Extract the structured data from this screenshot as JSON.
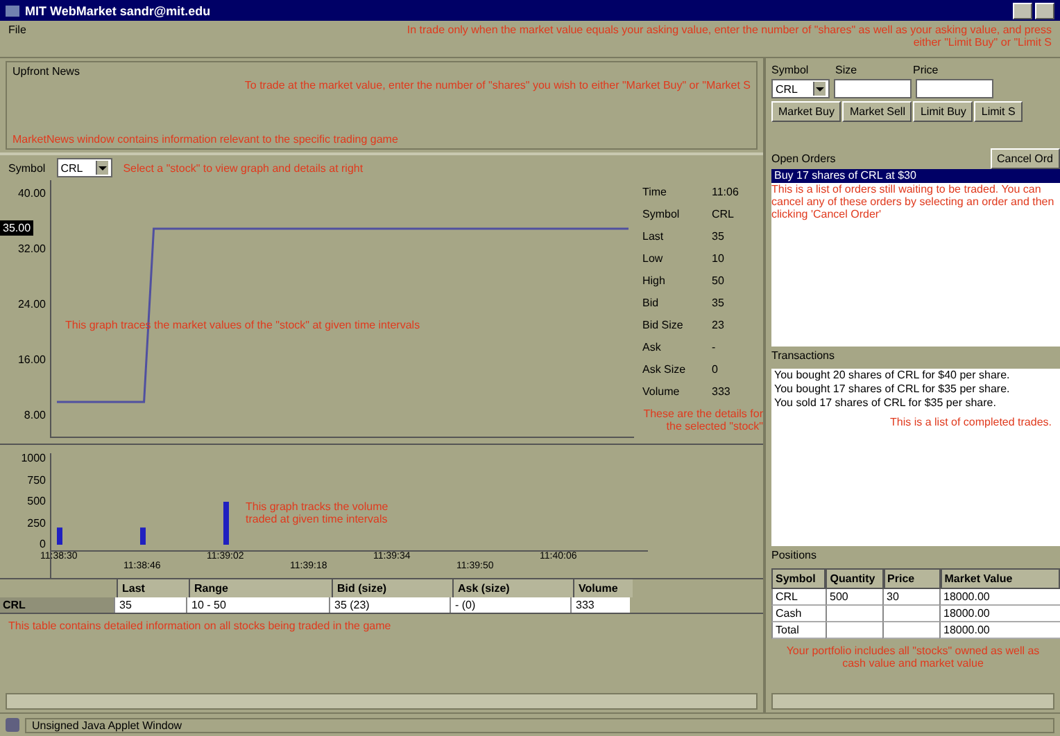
{
  "window": {
    "title": "MIT WebMarket  sandr@mit.edu"
  },
  "menu": [
    "File"
  ],
  "notes": {
    "limit": "In trade only when the market value equals your asking value, enter the number of \"shares\" as well as your asking value, and press either \"Limit Buy\" or \"Limit S",
    "market": "To trade at the market value, enter the number of \"shares\" you wish to either \"Market Buy\" or \"Market S",
    "news": "MarketNews window contains information relevant to the specific trading game",
    "select": "Select a \"stock\" to view graph and details at right",
    "price_graph": "This graph traces the market values of the \"stock\" at given time intervals",
    "details": "These are the details for the selected \"stock\"",
    "volume_graph": "This graph tracks the volume traded at given time intervals",
    "table": "This table contains detailed information on all stocks being traded in the game",
    "orders": "This is a list of orders still waiting to be traded. You can cancel any of these orders by selecting an order and then clicking 'Cancel Order'",
    "transactions": "This is a list of completed trades.",
    "positions": "Your portfolio includes all \"stocks\" owned as well as cash value and market value"
  },
  "news": {
    "title": "Upfront News"
  },
  "symbol_picker": {
    "label": "Symbol",
    "value": "CRL"
  },
  "price_chart": {
    "highlight": "35.00",
    "chart_data": {
      "type": "line",
      "categories": [
        null,
        null,
        null,
        null,
        null,
        null,
        null,
        null,
        null,
        null,
        null,
        null,
        null,
        null,
        null,
        null,
        null,
        null,
        null,
        null,
        null,
        null,
        null,
        null,
        null,
        null,
        null,
        null,
        null,
        null,
        null,
        null,
        null,
        null,
        null,
        null,
        null,
        null,
        null,
        null,
        null,
        null,
        null,
        null,
        null,
        null,
        null,
        null,
        null,
        null,
        null,
        null,
        null,
        null,
        null,
        null,
        null,
        null,
        null,
        null
      ],
      "ylim": [
        5,
        42
      ],
      "yticks": [
        {
          "value": 8,
          "label": "8.00"
        },
        {
          "value": 16,
          "label": "16.00"
        },
        {
          "value": 24,
          "label": "24.00"
        },
        {
          "value": 32,
          "label": "32.00"
        },
        {
          "value": 40,
          "label": "40.00"
        }
      ],
      "series": [
        {
          "color": "#5050a0",
          "values": [
            10,
            10,
            10,
            10,
            10,
            10,
            10,
            10,
            10,
            10,
            35,
            35,
            35,
            35,
            35,
            35,
            35,
            35,
            35,
            35,
            35,
            35,
            35,
            35,
            35,
            35,
            35,
            35,
            35,
            35,
            35,
            35,
            35,
            35,
            35,
            35,
            35,
            35,
            35,
            35,
            35,
            35,
            35,
            35,
            35,
            35,
            35,
            35,
            35,
            35,
            35,
            35,
            35,
            35,
            35,
            35,
            35,
            35,
            35,
            35
          ]
        }
      ]
    }
  },
  "details": [
    {
      "label": "Time",
      "value": "11:06"
    },
    {
      "label": "Symbol",
      "value": "CRL"
    },
    {
      "label": "Last",
      "value": "35"
    },
    {
      "label": "Low",
      "value": "10"
    },
    {
      "label": "High",
      "value": "50"
    },
    {
      "label": "Bid",
      "value": "35"
    },
    {
      "label": "Bid Size",
      "value": "23"
    },
    {
      "label": "Ask",
      "value": "-"
    },
    {
      "label": "Ask Size",
      "value": "0"
    },
    {
      "label": "Volume",
      "value": "333"
    }
  ],
  "volume_chart": {
    "chart_data": {
      "type": "bar",
      "categories": [
        "11:38:30",
        "11:38:46",
        "11:39:02",
        "11:39:18",
        "11:39:34",
        "11:39:50",
        "11:40:06"
      ],
      "ylim": [
        0,
        1000
      ],
      "yticks": [
        0,
        250,
        500,
        750,
        1000
      ],
      "series": [
        {
          "color": "#2020c0",
          "values": [
            200,
            200,
            500,
            null,
            null,
            null,
            null
          ]
        }
      ]
    }
  },
  "stocks_table": {
    "columns": [
      "Last",
      "Range",
      "Bid (size)",
      "Ask (size)",
      "Volume"
    ],
    "rows": [
      {
        "symbol": "CRL",
        "cells": [
          "35",
          "10  -  50",
          "35   (23)",
          "-   (0)",
          "333"
        ]
      }
    ]
  },
  "trade_form": {
    "symbol_label": "Symbol",
    "size_label": "Size",
    "price_label": "Price",
    "symbol": "CRL",
    "buttons": [
      "Market Buy",
      "Market Sell",
      "Limit Buy",
      "Limit S"
    ]
  },
  "open_orders": {
    "title": "Open Orders",
    "cancel_button": "Cancel Ord",
    "items": [
      {
        "text": "Buy 17 shares of CRL at $30",
        "selected": true
      }
    ]
  },
  "transactions": {
    "title": "Transactions",
    "items": [
      "You bought 20 shares of CRL for $40 per share.",
      "You bought 17 shares of CRL for $35 per share.",
      "You sold 17 shares of CRL for $35 per share."
    ]
  },
  "positions": {
    "title": "Positions",
    "columns": [
      "Symbol",
      "Quantity",
      "Price",
      "Market Value"
    ],
    "rows": [
      [
        "CRL",
        "500",
        "30",
        "18000.00"
      ],
      [
        "Cash",
        "",
        "",
        "18000.00"
      ],
      [
        "Total",
        "",
        "",
        "18000.00"
      ]
    ]
  },
  "status_bar": "Unsigned Java Applet Window"
}
